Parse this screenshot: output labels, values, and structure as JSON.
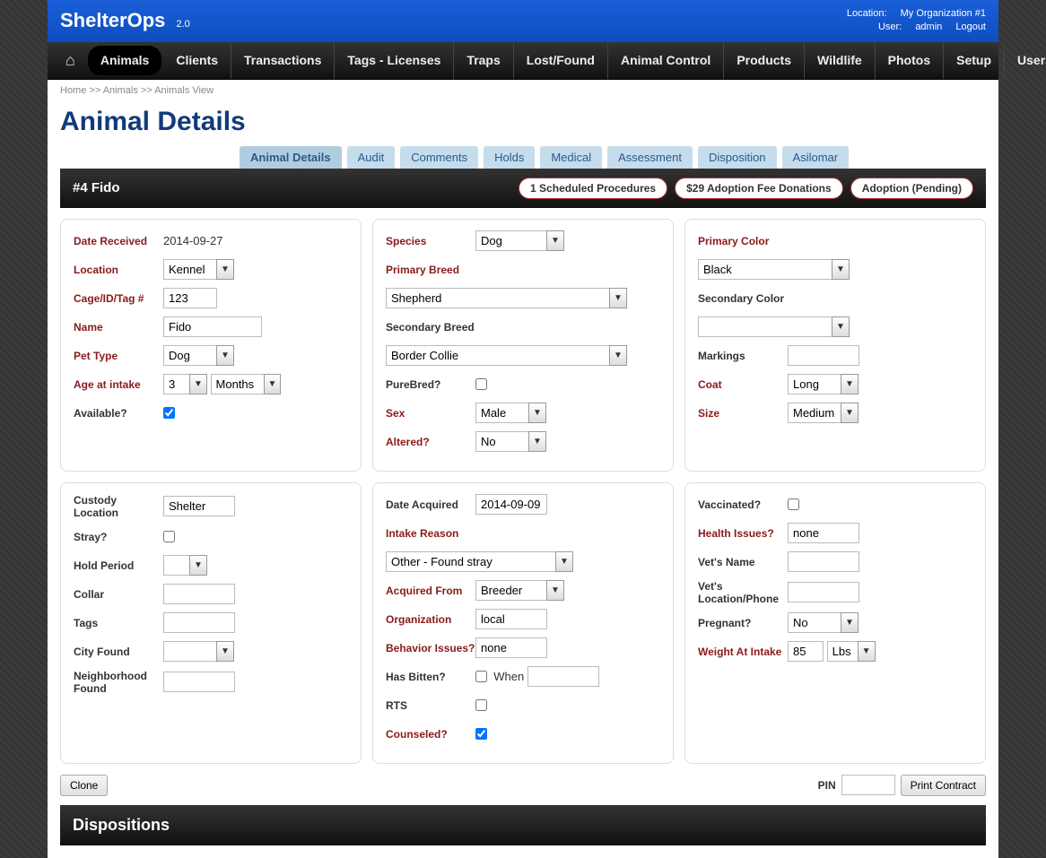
{
  "header": {
    "logo": "ShelterOps",
    "version": "2.0",
    "location_label": "Location:",
    "location": "My Organization #1",
    "user_label": "User:",
    "user": "admin",
    "logout": "Logout"
  },
  "nav": [
    "Animals",
    "Clients",
    "Transactions",
    "Tags - Licenses",
    "Traps",
    "Lost/Found",
    "Animal Control",
    "Products",
    "Wildlife",
    "Photos",
    "Setup",
    "Users"
  ],
  "breadcrumb": {
    "home": "Home",
    "sep": ">>",
    "animals": "Animals",
    "view": "Animals View"
  },
  "title": "Animal Details",
  "tabs": [
    "Animal Details",
    "Audit",
    "Comments",
    "Holds",
    "Medical",
    "Assessment",
    "Disposition",
    "Asilomar"
  ],
  "idbar": {
    "id": "#4 Fido",
    "pills": [
      "1 Scheduled Procedures",
      "$29 Adoption Fee Donations",
      "Adoption (Pending)"
    ]
  },
  "labels": {
    "date_received": "Date Received",
    "location": "Location",
    "cage": "Cage/ID/Tag #",
    "name": "Name",
    "pet_type": "Pet Type",
    "age_intake": "Age at intake",
    "available": "Available?",
    "species": "Species",
    "primary_breed": "Primary Breed",
    "secondary_breed": "Secondary Breed",
    "purebred": "PureBred?",
    "sex": "Sex",
    "altered": "Altered?",
    "primary_color": "Primary Color",
    "secondary_color": "Secondary Color",
    "markings": "Markings",
    "coat": "Coat",
    "size": "Size",
    "custody_location": "Custody Location",
    "stray": "Stray?",
    "hold_period": "Hold Period",
    "collar": "Collar",
    "tags": "Tags",
    "city_found": "City Found",
    "neighborhood": "Neighborhood Found",
    "date_acquired": "Date Acquired",
    "intake_reason": "Intake Reason",
    "acquired_from": "Acquired From",
    "organization": "Organization",
    "behavior": "Behavior Issues?",
    "has_bitten": "Has Bitten?",
    "when": "When",
    "rts": "RTS",
    "counseled": "Counseled?",
    "vaccinated": "Vaccinated?",
    "health_issues": "Health Issues?",
    "vets_name": "Vet's Name",
    "vets_loc": "Vet's Location/Phone",
    "pregnant": "Pregnant?",
    "weight_intake": "Weight At Intake"
  },
  "values": {
    "date_received": "2014-09-27",
    "location": "Kennel",
    "cage": "123",
    "name": "Fido",
    "pet_type": "Dog",
    "age_num": "3",
    "age_unit": "Months",
    "species": "Dog",
    "primary_breed": "Shepherd",
    "secondary_breed": "Border Collie",
    "sex": "Male",
    "altered": "No",
    "primary_color": "Black",
    "secondary_color": "",
    "markings": "",
    "coat": "Long",
    "size": "Medium",
    "custody_location": "Shelter",
    "hold_period": "",
    "collar": "",
    "tags": "",
    "city_found": "",
    "neighborhood": "",
    "date_acquired": "2014-09-09",
    "intake_reason": "Other - Found stray",
    "acquired_from": "Breeder",
    "organization": "local",
    "behavior": "none",
    "when": "",
    "health_issues": "none",
    "vets_name": "",
    "vets_loc": "",
    "pregnant": "No",
    "weight": "85",
    "weight_unit": "Lbs"
  },
  "footer": {
    "clone": "Clone",
    "pin": "PIN",
    "print": "Print Contract"
  },
  "dispositions": "Dispositions"
}
